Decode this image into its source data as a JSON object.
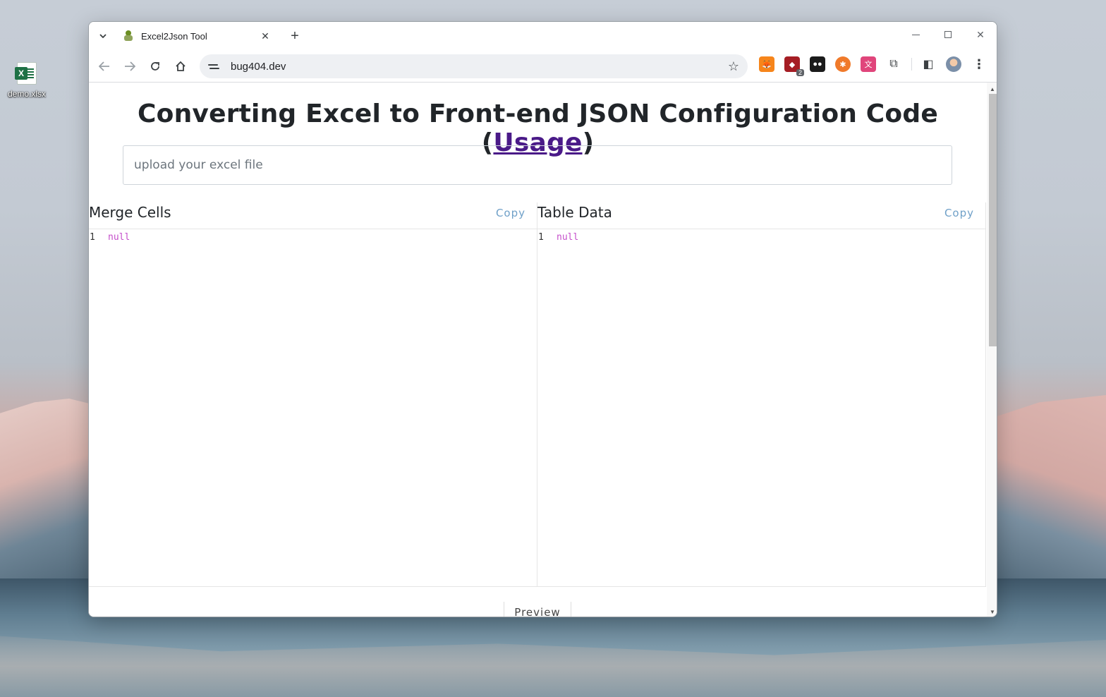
{
  "desktop": {
    "file_icon_label": "demo.xlsx"
  },
  "browser": {
    "tab_title": "Excel2Json Tool",
    "tab_close": "✕",
    "new_tab": "+",
    "url": "bug404.dev",
    "extension_badge": "2",
    "window_close": "✕"
  },
  "page": {
    "title_main": "Converting Excel to Front-end JSON Configuration Code (",
    "title_link": "Usage",
    "title_end": ")",
    "upload_placeholder": "upload your excel file",
    "preview_label": "Preview",
    "panels": [
      {
        "title": "Merge Cells",
        "copy_label": "Copy",
        "line_number": "1",
        "code": "null"
      },
      {
        "title": "Table Data",
        "copy_label": "Copy",
        "line_number": "1",
        "code": "null"
      }
    ]
  },
  "colors": {
    "link": "#4a1a88",
    "copy": "#6fa0c8",
    "code_value": "#c54ecb"
  }
}
